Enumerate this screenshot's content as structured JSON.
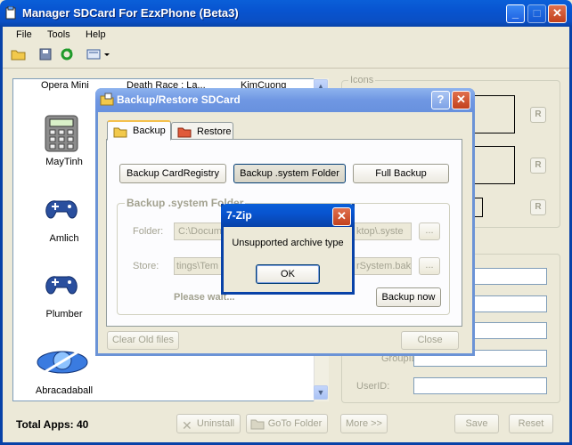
{
  "window": {
    "title": "Manager SDCard For EzxPhone (Beta3)"
  },
  "menu": [
    "File",
    "Tools",
    "Help"
  ],
  "toolbar_icons": [
    "open-folder-icon",
    "save-icon",
    "refresh-icon",
    "view-icon"
  ],
  "apps": {
    "top_row": [
      "Opera Mini",
      "Death Race : La...",
      "KimCuong"
    ],
    "items": [
      "MayTinh",
      "Amlich",
      "Plumber",
      "Abracadaball"
    ]
  },
  "right_panel": {
    "icons_label": "Icons",
    "r_button": "R",
    "group_label": "GroupID:",
    "user_label": "UserID:"
  },
  "bottom": {
    "total": "Total Apps: 40",
    "uninstall": "Uninstall",
    "goto_folder": "GoTo Folder",
    "more": "More >>",
    "save": "Save",
    "reset": "Reset"
  },
  "backup_dialog": {
    "title": "Backup/Restore SDCard",
    "help": "?",
    "tabs": [
      "Backup",
      "Restore"
    ],
    "buttons": [
      "Backup CardRegistry",
      "Backup .system Folder",
      "Full Backup"
    ],
    "group_title": "Backup .system Folder",
    "folder_label": "Folder:",
    "folder_value_left": "C:\\Docum",
    "folder_value_right": "ktop\\.syste",
    "store_label": "Store:",
    "store_value_left": "tings\\Tem",
    "store_value_right": "rSystem.bak",
    "browse": "...",
    "wait_text": "Please wait...",
    "backup_now": "Backup now",
    "clear_old": "Clear Old files",
    "close": "Close"
  },
  "zip_dialog": {
    "title": "7-Zip",
    "message": "Unsupported archive type",
    "ok": "OK"
  }
}
